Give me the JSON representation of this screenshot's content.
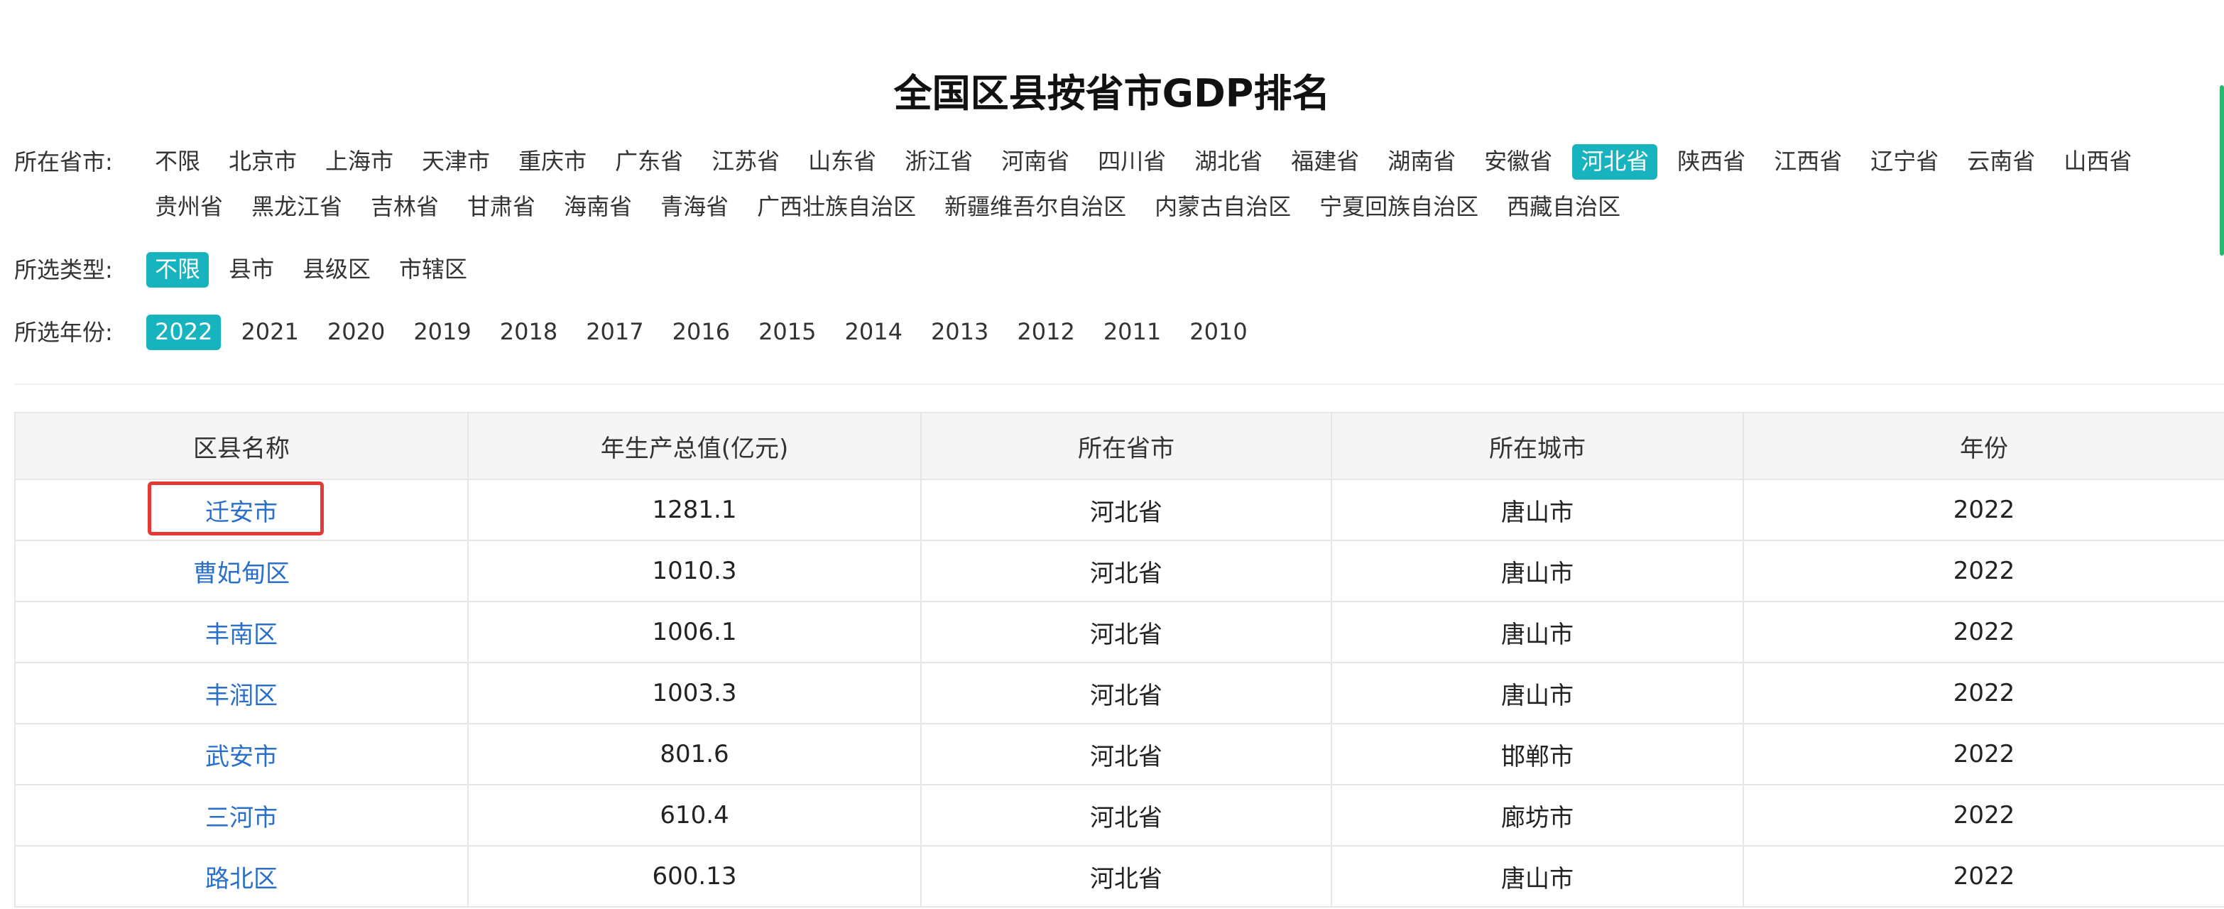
{
  "title": "全国区县按省市GDP排名",
  "filters": {
    "province": {
      "label": "所在省市:",
      "options": [
        "不限",
        "北京市",
        "上海市",
        "天津市",
        "重庆市",
        "广东省",
        "江苏省",
        "山东省",
        "浙江省",
        "河南省",
        "四川省",
        "湖北省",
        "福建省",
        "湖南省",
        "安徽省",
        "河北省",
        "陕西省",
        "江西省",
        "辽宁省",
        "云南省",
        "山西省",
        "贵州省",
        "黑龙江省",
        "吉林省",
        "甘肃省",
        "海南省",
        "青海省",
        "广西壮族自治区",
        "新疆维吾尔自治区",
        "内蒙古自治区",
        "宁夏回族自治区",
        "西藏自治区"
      ],
      "selected": "河北省"
    },
    "type": {
      "label": "所选类型:",
      "options": [
        "不限",
        "县市",
        "县级区",
        "市辖区"
      ],
      "selected": "不限"
    },
    "year": {
      "label": "所选年份:",
      "options": [
        "2022",
        "2021",
        "2020",
        "2019",
        "2018",
        "2017",
        "2016",
        "2015",
        "2014",
        "2013",
        "2012",
        "2011",
        "2010"
      ],
      "selected": "2022"
    }
  },
  "table": {
    "headers": [
      "区县名称",
      "年生产总值(亿元)",
      "所在省市",
      "所在城市",
      "年份"
    ],
    "rows": [
      {
        "name": "迁安市",
        "gdp": "1281.1",
        "province": "河北省",
        "city": "唐山市",
        "year": "2022"
      },
      {
        "name": "曹妃甸区",
        "gdp": "1010.3",
        "province": "河北省",
        "city": "唐山市",
        "year": "2022"
      },
      {
        "name": "丰南区",
        "gdp": "1006.1",
        "province": "河北省",
        "city": "唐山市",
        "year": "2022"
      },
      {
        "name": "丰润区",
        "gdp": "1003.3",
        "province": "河北省",
        "city": "唐山市",
        "year": "2022"
      },
      {
        "name": "武安市",
        "gdp": "801.6",
        "province": "河北省",
        "city": "邯郸市",
        "year": "2022"
      },
      {
        "name": "三河市",
        "gdp": "610.4",
        "province": "河北省",
        "city": "廊坊市",
        "year": "2022"
      },
      {
        "name": "路北区",
        "gdp": "600.13",
        "province": "河北省",
        "city": "唐山市",
        "year": "2022"
      }
    ]
  },
  "colors": {
    "accent": "#17b3bf",
    "link": "#2a6fc9",
    "highlight": "#e53935",
    "scroll_indicator": "#2bb673"
  }
}
